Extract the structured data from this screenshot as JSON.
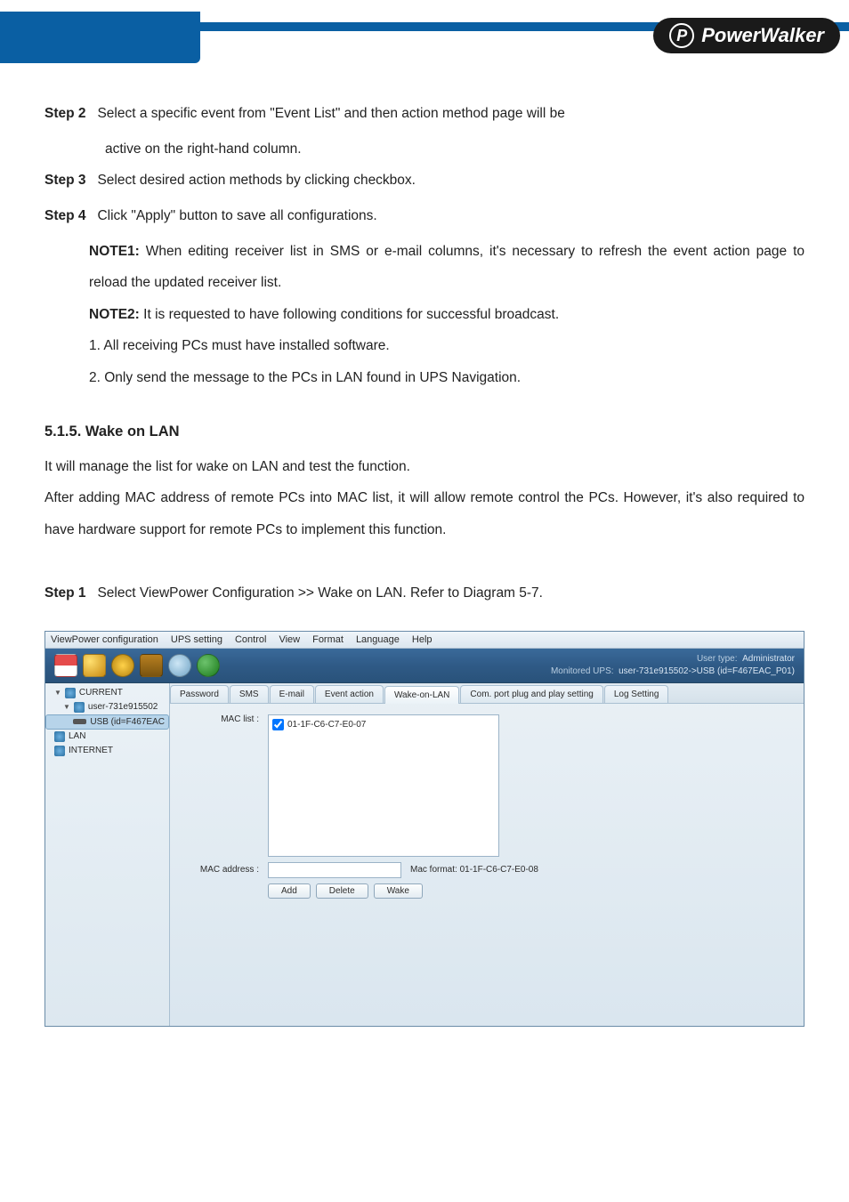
{
  "brand": {
    "symbol": "P",
    "name": "PowerWalker"
  },
  "doc": {
    "step2_label": "Step 2",
    "step2_text_a": "Select a specific event from \"Event List\" and then action method page will be",
    "step2_text_b": "active on the right-hand column.",
    "step3_label": "Step 3",
    "step3_text": "Select desired action methods by clicking checkbox.",
    "step4_label": "Step 4",
    "step4_text": "Click \"Apply\" button to save all configurations.",
    "note1_label": "NOTE1:",
    "note1_text": " When editing receiver list in SMS or e-mail columns, it's necessary to refresh the event action page to reload the updated receiver list.",
    "note2_label": "NOTE2:",
    "note2_text": " It is requested to have following conditions for successful broadcast.",
    "li1": "1.  All receiving PCs must have installed software.",
    "li2": "2.  Only send the message to the PCs in LAN found in UPS Navigation.",
    "section_heading": "5.1.5. Wake on LAN",
    "section_p1": "It will manage the list for wake on LAN and test the function.",
    "section_p2": "After adding MAC address of remote PCs into MAC list, it will allow remote control the PCs. However, it's also required to have hardware support for remote PCs to implement this function.",
    "step1_label": "Step 1",
    "step1_text": "Select ViewPower Configuration >> Wake on LAN. Refer to Diagram 5-7."
  },
  "app": {
    "menu": {
      "viewpower": "ViewPower configuration",
      "ups": "UPS setting",
      "control": "Control",
      "view": "View",
      "format": "Format",
      "language": "Language",
      "help": "Help"
    },
    "userinfo": {
      "type_label": "User type:",
      "type_value": "Administrator",
      "mon_label": "Monitored UPS:",
      "mon_value": "user-731e915502->USB (id=F467EAC_P01)"
    },
    "tree": {
      "current": "CURRENT",
      "user": "user-731e915502",
      "usb": "USB (id=F467EAC",
      "lan": "LAN",
      "internet": "INTERNET"
    },
    "tabs": {
      "password": "Password",
      "sms": "SMS",
      "email": "E-mail",
      "event_action": "Event action",
      "wake_on_lan": "Wake-on-LAN",
      "com_port": "Com. port plug and play setting",
      "log_setting": "Log Setting"
    },
    "form": {
      "mac_list_label": "MAC list :",
      "mac_item": "01-1F-C6-C7-E0-07",
      "mac_addr_label": "MAC address :",
      "mac_format": "Mac format: 01-1F-C6-C7-E0-08",
      "btn_add": "Add",
      "btn_delete": "Delete",
      "btn_wake": "Wake"
    }
  }
}
